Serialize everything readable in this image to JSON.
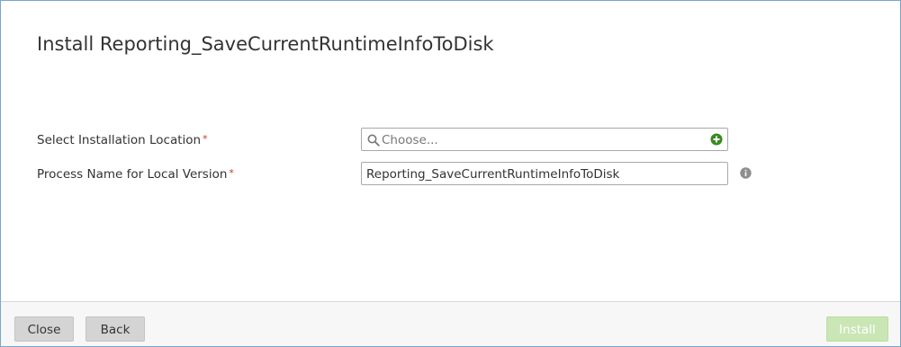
{
  "dialog": {
    "title": "Install Reporting_SaveCurrentRuntimeInfoToDisk"
  },
  "form": {
    "location": {
      "label": "Select Installation Location",
      "required_mark": "*",
      "placeholder": "Choose...",
      "icon": "search-icon",
      "add_icon": "add-icon"
    },
    "process_name": {
      "label": "Process Name for Local Version",
      "required_mark": "*",
      "value": "Reporting_SaveCurrentRuntimeInfoToDisk",
      "info_icon": "info-icon"
    }
  },
  "footer": {
    "close_label": "Close",
    "back_label": "Back",
    "install_label": "Install"
  },
  "colors": {
    "required": "#c0392b",
    "add_icon": "#3a8a1f",
    "install_disabled": "#c9e6b4"
  }
}
